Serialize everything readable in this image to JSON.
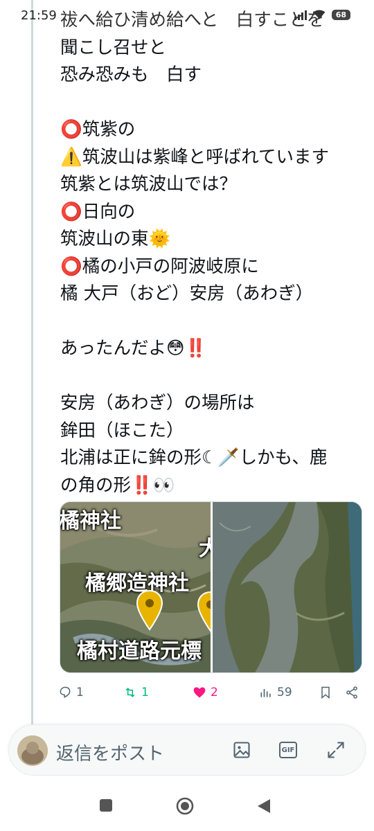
{
  "status_bar": {
    "time": "21:59",
    "battery": "68"
  },
  "tweet": {
    "lines": [
      "祓へ給ひ清め給へと　白すことを",
      "聞こし召せと",
      "恐み恐みも　白す",
      "",
      "⭕筑紫の",
      "⚠️筑波山は紫峰と呼ばれています",
      "筑紫とは筑波山では？",
      "⭕日向の",
      "筑波山の東🌞",
      "⭕橘の小戸の阿波岐原に",
      "橘 大戸（おど）安房（あわぎ）",
      "",
      "あったんだよ😳‼️",
      "",
      "安房（あわぎ）の場所は",
      "鉾田（ほこた）",
      "北浦は正に鉾の形☾🗡️しかも、鹿",
      "の角の形‼️👀"
    ],
    "media": {
      "left_labels": [
        "橘神社",
        "橘郷造神社",
        "橘村道路元標",
        "大"
      ]
    }
  },
  "actions": {
    "replies": "1",
    "retweets": "1",
    "likes": "2",
    "views": "59"
  },
  "reply_bar": {
    "placeholder": "返信をポスト",
    "gif_label": "GIF"
  },
  "colors": {
    "retweet_green": "#00ba7c",
    "like_pink": "#f91880",
    "secondary_text": "#536471"
  }
}
